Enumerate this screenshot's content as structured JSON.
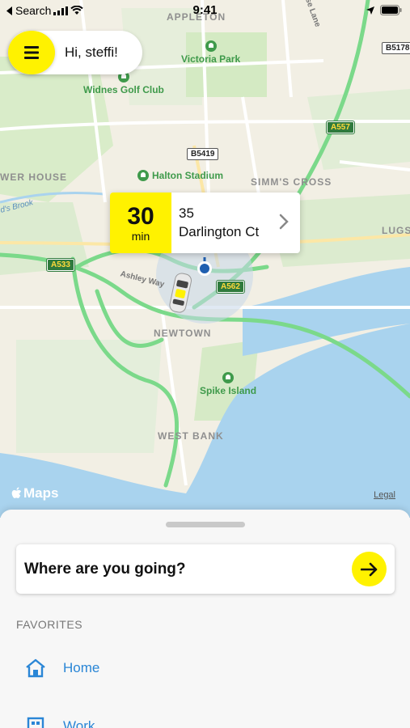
{
  "status_bar": {
    "back_label": "Search",
    "time": "9:41"
  },
  "greeting": {
    "text": "Hi, steffi!"
  },
  "map": {
    "places": [
      "APPLETON",
      "SIMM'S CROSS",
      "NEWTOWN",
      "WEST BANK",
      "WER HOUSE",
      "LUGS"
    ],
    "pois": [
      "Victoria Park",
      "Widnes Golf Club",
      "Halton Stadium",
      "Spike Island"
    ],
    "road_shields": [
      "B5178",
      "A557",
      "B5419",
      "A533",
      "A562"
    ],
    "streets": [
      "Ashley Way",
      "d's Brook",
      "se Lane"
    ],
    "attribution": "Maps",
    "legal": "Legal"
  },
  "eta_card": {
    "minutes": "30",
    "unit": "min",
    "address_line1": "35",
    "address_line2": "Darlington Ct"
  },
  "sheet": {
    "search_prompt": "Where are you going?",
    "favorites_title": "FAVORITES",
    "favorites": [
      {
        "label": "Home",
        "icon": "home-icon"
      },
      {
        "label": "Work",
        "icon": "work-icon"
      }
    ]
  },
  "colors": {
    "accent_yellow": "#fff200",
    "link_blue": "#2a86d6",
    "road_green": "#7bd98a",
    "water": "#a9d3ee"
  }
}
